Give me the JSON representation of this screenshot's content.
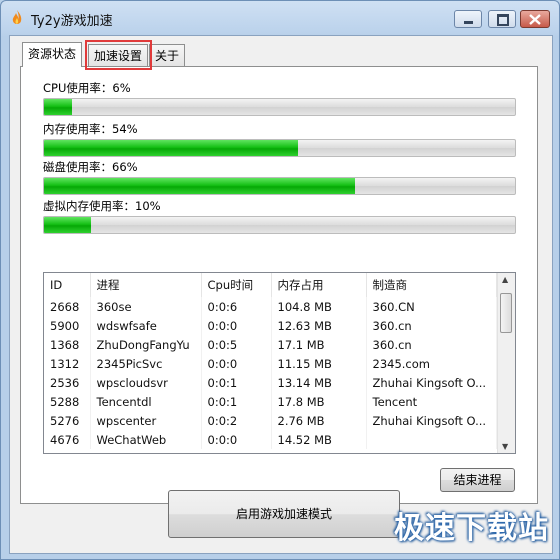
{
  "window": {
    "title": "Ty2y游戏加速"
  },
  "tabs": [
    {
      "label": "资源状态",
      "active": true
    },
    {
      "label": "加速设置",
      "active": false
    },
    {
      "label": "关于",
      "active": false
    }
  ],
  "meters": [
    {
      "label": "CPU使用率：6%",
      "percent": 6
    },
    {
      "label": "内存使用率：54%",
      "percent": 54
    },
    {
      "label": "磁盘使用率：66%",
      "percent": 66
    },
    {
      "label": "虚拟内存使用率：10%",
      "percent": 10
    }
  ],
  "process_list": {
    "columns": [
      "ID",
      "进程",
      "Cpu时间",
      "内存占用",
      "制造商"
    ],
    "rows": [
      [
        "2668",
        "360se",
        "0:0:6",
        "104.8 MB",
        "360.CN"
      ],
      [
        "5900",
        "wdswfsafe",
        "0:0:0",
        "12.63 MB",
        "360.cn"
      ],
      [
        "1368",
        "ZhuDongFangYu",
        "0:0:5",
        "17.1 MB",
        "360.cn"
      ],
      [
        "1312",
        "2345PicSvc",
        "0:0:0",
        "11.15 MB",
        "2345.com"
      ],
      [
        "2536",
        "wpscloudsvr",
        "0:0:1",
        "13.14 MB",
        "Zhuhai Kingsoft O..."
      ],
      [
        "5288",
        "Tencentdl",
        "0:0:1",
        "17.8 MB",
        "Tencent"
      ],
      [
        "5276",
        "wpscenter",
        "0:0:2",
        "2.76 MB",
        "Zhuhai Kingsoft O..."
      ],
      [
        "4676",
        "WeChatWeb",
        "0:0:0",
        "14.52 MB",
        ""
      ]
    ]
  },
  "buttons": {
    "end_process": "结束进程",
    "enable_mode": "启用游戏加速模式"
  },
  "watermark": "极速下载站",
  "colors": {
    "meter_fill": "#16c016",
    "highlight": "#e03a3a",
    "titlebar": "#bcd3ec"
  }
}
